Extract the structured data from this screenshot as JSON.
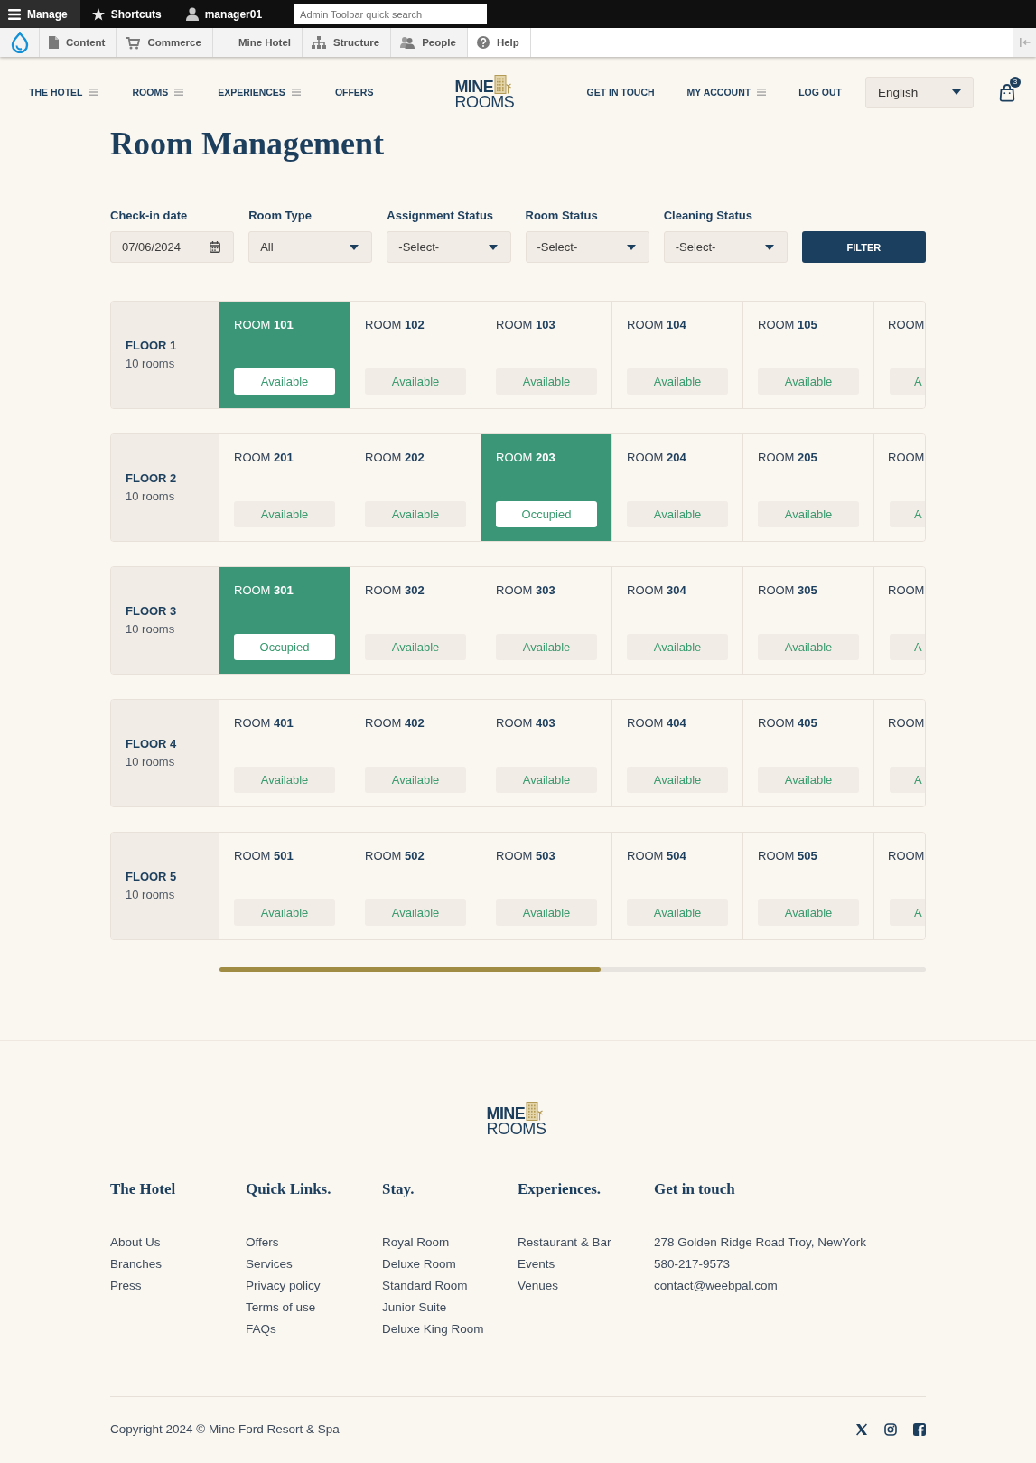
{
  "admin_toolbar": {
    "tabs": [
      {
        "label": "Manage",
        "selected": true
      },
      {
        "label": "Shortcuts",
        "selected": false
      },
      {
        "label": "manager01",
        "selected": false
      }
    ],
    "search": {
      "placeholder": "Admin Toolbar quick search"
    }
  },
  "admin_menu": {
    "items": [
      {
        "label": "Content"
      },
      {
        "label": "Commerce"
      },
      {
        "label": "Mine Hotel"
      },
      {
        "label": "Structure"
      },
      {
        "label": "People"
      },
      {
        "label": "Help"
      }
    ]
  },
  "main_nav": {
    "left": [
      {
        "label": "THE HOTEL",
        "has_submenu": true
      },
      {
        "label": "ROOMS",
        "has_submenu": true
      },
      {
        "label": "EXPERIENCES",
        "has_submenu": true
      },
      {
        "label": "OFFERS",
        "has_submenu": false
      }
    ],
    "logo": {
      "line_1": "MINE",
      "line_2": "ROOMS"
    },
    "right": [
      {
        "label": "GET IN TOUCH",
        "has_submenu": false
      },
      {
        "label": "MY ACCOUNT",
        "has_submenu": true
      },
      {
        "label": "LOG OUT",
        "has_submenu": false
      }
    ],
    "language": {
      "value": "English"
    },
    "cart": {
      "count": "3"
    }
  },
  "page": {
    "title": "Room Management",
    "filters": [
      {
        "kind": "date",
        "label": "Check-in date",
        "value": "07/06/2024"
      },
      {
        "kind": "select",
        "label": "Room Type",
        "value": "All"
      },
      {
        "kind": "select",
        "label": "Assignment Status",
        "value": "-Select-"
      },
      {
        "kind": "select",
        "label": "Room Status",
        "value": "-Select-"
      },
      {
        "kind": "select",
        "label": "Cleaning Status",
        "value": "-Select-"
      }
    ],
    "filter_button": "FILTER",
    "floors": [
      {
        "name": "FLOOR 1",
        "count": "10 rooms",
        "rooms": [
          {
            "name": "ROOM **101**",
            "status": "Available",
            "selected": true
          },
          {
            "name": "ROOM **102**",
            "status": "Available",
            "selected": false
          },
          {
            "name": "ROOM **103**",
            "status": "Available",
            "selected": false
          },
          {
            "name": "ROOM **104**",
            "status": "Available",
            "selected": false
          },
          {
            "name": "ROOM **105**",
            "status": "Available",
            "selected": false
          },
          {
            "name": "ROOM",
            "status": "A",
            "selected": false
          }
        ]
      },
      {
        "name": "FLOOR 2",
        "count": "10 rooms",
        "rooms": [
          {
            "name": "ROOM **201**",
            "status": "Available",
            "selected": false
          },
          {
            "name": "ROOM **202**",
            "status": "Available",
            "selected": false
          },
          {
            "name": "ROOM **203**",
            "status": "Occupied",
            "selected": true
          },
          {
            "name": "ROOM **204**",
            "status": "Available",
            "selected": false
          },
          {
            "name": "ROOM **205**",
            "status": "Available",
            "selected": false
          },
          {
            "name": "ROOM",
            "status": "A",
            "selected": false
          }
        ]
      },
      {
        "name": "FLOOR 3",
        "count": "10 rooms",
        "rooms": [
          {
            "name": "ROOM **301**",
            "status": "Occupied",
            "selected": true
          },
          {
            "name": "ROOM **302**",
            "status": "Available",
            "selected": false
          },
          {
            "name": "ROOM **303**",
            "status": "Available",
            "selected": false
          },
          {
            "name": "ROOM **304**",
            "status": "Available",
            "selected": false
          },
          {
            "name": "ROOM **305**",
            "status": "Available",
            "selected": false
          },
          {
            "name": "ROOM",
            "status": "A",
            "selected": false
          }
        ]
      },
      {
        "name": "FLOOR 4",
        "count": "10 rooms",
        "rooms": [
          {
            "name": "ROOM **401**",
            "status": "Available",
            "selected": false
          },
          {
            "name": "ROOM **402**",
            "status": "Available",
            "selected": false
          },
          {
            "name": "ROOM **403**",
            "status": "Available",
            "selected": false
          },
          {
            "name": "ROOM **404**",
            "status": "Available",
            "selected": false
          },
          {
            "name": "ROOM **405**",
            "status": "Available",
            "selected": false
          },
          {
            "name": "ROOM",
            "status": "A",
            "selected": false
          }
        ]
      },
      {
        "name": "FLOOR 5",
        "count": "10 rooms",
        "rooms": [
          {
            "name": "ROOM **501**",
            "status": "Available",
            "selected": false
          },
          {
            "name": "ROOM **502**",
            "status": "Available",
            "selected": false
          },
          {
            "name": "ROOM **503**",
            "status": "Available",
            "selected": false
          },
          {
            "name": "ROOM **504**",
            "status": "Available",
            "selected": false
          },
          {
            "name": "ROOM **505**",
            "status": "Available",
            "selected": false
          },
          {
            "name": "ROOM",
            "status": "A",
            "selected": false
          }
        ]
      }
    ]
  },
  "footer": {
    "logo": {
      "line_1": "MINE",
      "line_2": "ROOMS"
    },
    "columns": [
      {
        "title": "The Hotel",
        "links": [
          "About Us",
          "Branches",
          "Press"
        ]
      },
      {
        "title": "Quick Links.",
        "links": [
          "Offers",
          "Services",
          "Privacy policy",
          "Terms of use",
          "FAQs"
        ]
      },
      {
        "title": "Stay.",
        "links": [
          "Royal Room",
          "Deluxe Room",
          "Standard Room",
          "Junior Suite",
          "Deluxe King Room"
        ]
      },
      {
        "title": "Experiences.",
        "links": [
          "Restaurant & Bar",
          "Events",
          "Venues"
        ]
      },
      {
        "title": "Get in touch",
        "links": [
          "278 Golden Ridge Road Troy, NewYork",
          "580-217-9573",
          "contact@weebpal.com"
        ]
      }
    ],
    "copyright": "Copyright 2024 © Mine Ford Resort & Spa"
  }
}
